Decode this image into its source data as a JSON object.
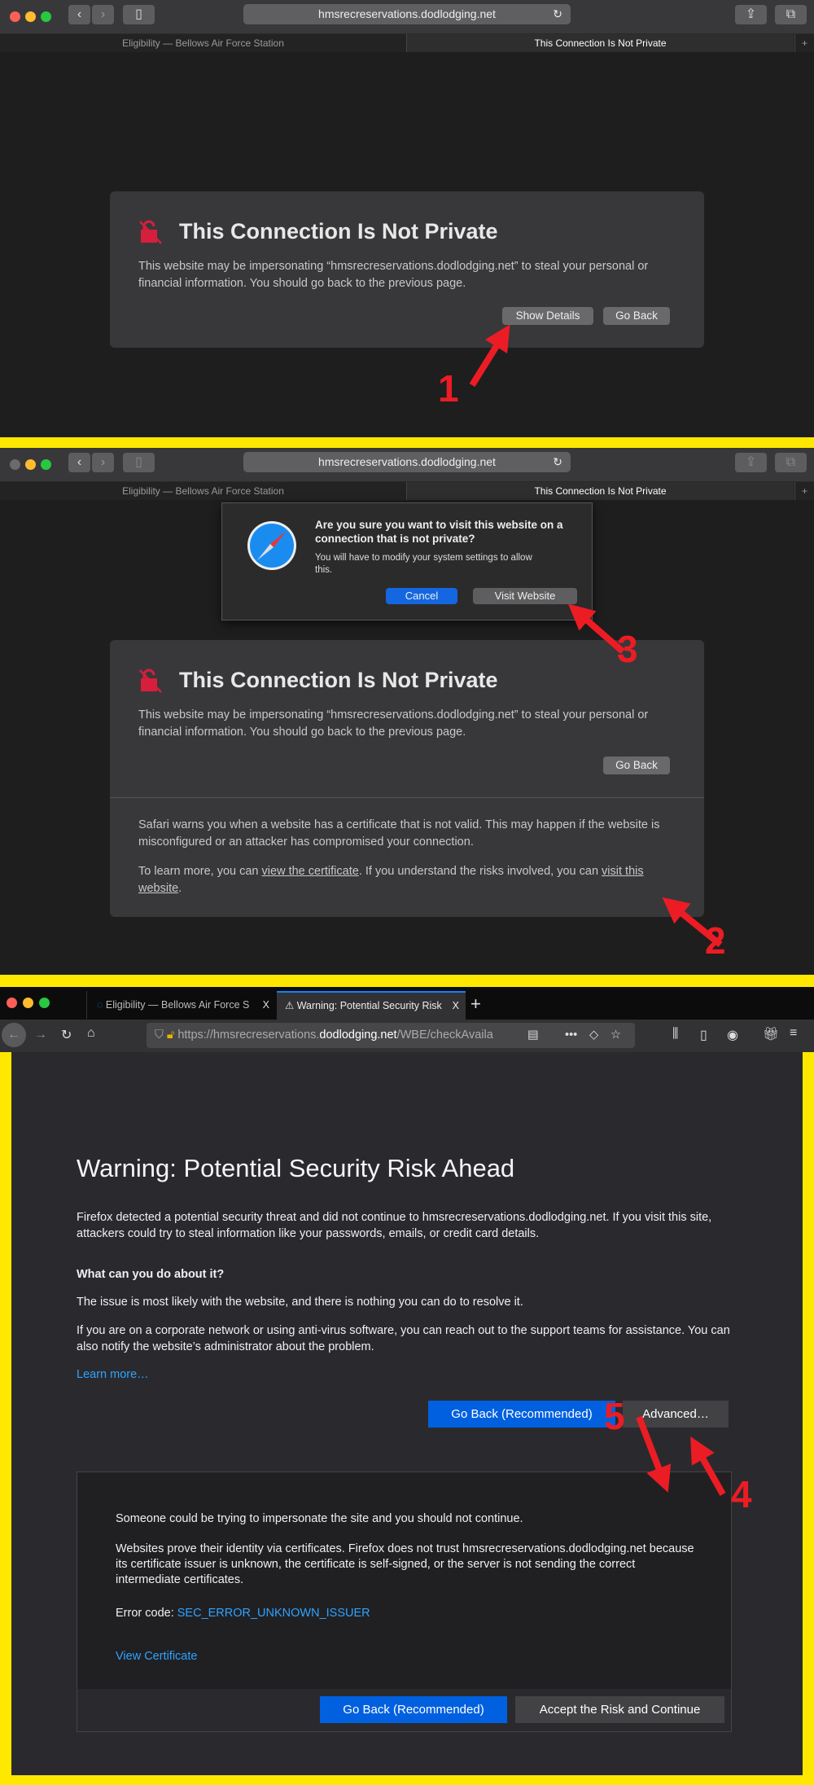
{
  "colors": {
    "annotation": "#ec1c24",
    "frame": "#ffe800",
    "safari_blue": "#1467e0",
    "firefox_blue": "#0060df",
    "link": "#2ea3ff"
  },
  "safari": {
    "url": "hmsrecreservations.dodlodging.net",
    "tabs": [
      {
        "label": "Eligibility — Bellows Air Force Station"
      },
      {
        "label": "This Connection Is Not Private"
      }
    ],
    "new_tab": "+",
    "page": {
      "title": "This Connection Is Not Private",
      "body": "This website may be impersonating “hmsrecreservations.dodlodging.net” to steal your personal or financial information. You should go back to the previous page.",
      "show_details": "Show Details",
      "go_back": "Go Back",
      "details_1": "Safari warns you when a website has a certificate that is not valid. This may happen if the website is misconfigured or an attacker has compromised your connection.",
      "details_2_prefix": "To learn more, you can ",
      "view_certificate": "view the certificate",
      "details_2_mid": ". If you understand the risks involved, you can ",
      "visit_website_link": "visit this website",
      "details_2_suffix": "."
    },
    "alert": {
      "title": "Are you sure you want to visit this website on a connection that is not private?",
      "message": "You will have to modify your system settings to allow this.",
      "cancel": "Cancel",
      "visit": "Visit Website"
    }
  },
  "firefox": {
    "tabs": [
      {
        "label": "Eligibility — Bellows Air Force S",
        "close": "X"
      },
      {
        "label": "Warning: Potential Security Risk",
        "close": "X"
      }
    ],
    "new_tab": "+",
    "url_prefix": "https://hmsrecreservations.",
    "url_domain": "dodlodging.net",
    "url_suffix": "/WBE/checkAvaila",
    "page": {
      "title": "Warning: Potential Security Risk Ahead",
      "intro": "Firefox detected a potential security threat and did not continue to hmsrecreservations.dodlodging.net. If you visit this site, attackers could try to steal information like your passwords, emails, or credit card details.",
      "what_heading": "What can you do about it?",
      "what_1": "The issue is most likely with the website, and there is nothing you can do to resolve it.",
      "what_2": "If you are on a corporate network or using anti-virus software, you can reach out to the support teams for assistance. You can also notify the website’s administrator about the problem.",
      "learn_more": "Learn more…",
      "go_back": "Go Back (Recommended)",
      "advanced": "Advanced…",
      "adv_1": "Someone could be trying to impersonate the site and you should not continue.",
      "adv_2": "Websites prove their identity via certificates. Firefox does not trust hmsrecreservations.dodlodging.net because its certificate issuer is unknown, the certificate is self-signed, or the server is not sending the correct intermediate certificates.",
      "error_label": "Error code: ",
      "error_code": "SEC_ERROR_UNKNOWN_ISSUER",
      "view_certificate": "View Certificate",
      "accept": "Accept the Risk and Continue"
    }
  },
  "annotations": [
    "1",
    "2",
    "3",
    "4",
    "5"
  ]
}
